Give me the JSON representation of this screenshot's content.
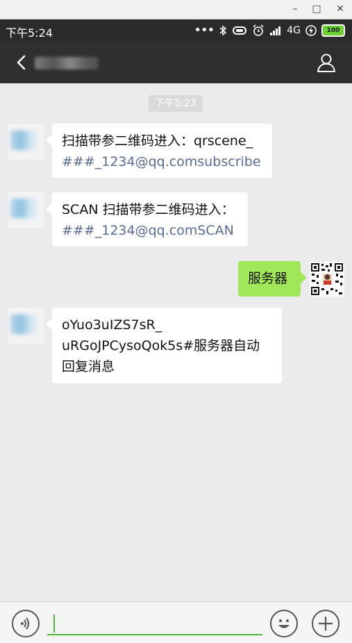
{
  "window": {
    "minimize": "–",
    "maximize": "□",
    "close": "✕"
  },
  "status_bar": {
    "time": "下午5:24",
    "network": "4G",
    "battery": "100"
  },
  "chat_header": {
    "back_icon": "chevron-left",
    "profile_icon": "person"
  },
  "timestamp": "下午5:23",
  "messages": [
    {
      "direction": "in",
      "text": "扫描带参二维码进入：qrscene_",
      "link": "###_1234@qq.comsubscribe",
      "text_after": ""
    },
    {
      "direction": "in",
      "text": "SCAN 扫描带参二维码进入：",
      "link": "###_1234@qq.comSCAN",
      "text_after": ""
    },
    {
      "direction": "out",
      "text": "服务器"
    },
    {
      "direction": "in",
      "lines": [
        "oYuo3uIZS7sR_",
        "uRGoJPCysoQok5s#服务器自动",
        "回复消息"
      ]
    }
  ],
  "input_bar": {
    "value": "",
    "placeholder": ""
  },
  "colors": {
    "header": "#2f2f31",
    "chat_bg": "#ebebeb",
    "outgoing_bubble": "#a0e75a",
    "link": "#576b95",
    "input_accent": "#46b934"
  }
}
